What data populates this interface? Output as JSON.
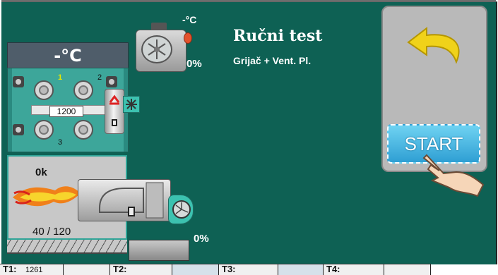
{
  "screen": {
    "title": "Ručni test",
    "subtitle": "Grijač + Vent. Pl."
  },
  "heater": {
    "temperature": "-°C",
    "pipe_value": "1200",
    "valve_numbers": [
      "1",
      "2",
      "3"
    ]
  },
  "blower": {
    "temperature": "-°C",
    "percent": "0%"
  },
  "burner": {
    "power_label": "0k",
    "fraction": "40 / 120",
    "fan_percent": "0%"
  },
  "controls": {
    "start_label": "START",
    "back_icon": "back-arrow-icon",
    "hand_icon": "pointing-hand-icon"
  },
  "sensors": [
    {
      "label": "T1:",
      "value": "1261"
    },
    {
      "label": "T2:",
      "value": ""
    },
    {
      "label": "T3:",
      "value": ""
    },
    {
      "label": "T4:",
      "value": ""
    }
  ],
  "colors": {
    "background": "#0e6154",
    "heater_body": "#3da69a",
    "start_button": "#2f9fd3",
    "back_arrow": "#f0d21a"
  }
}
